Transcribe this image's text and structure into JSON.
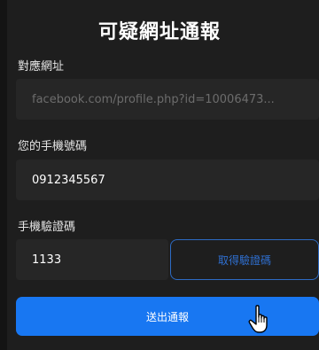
{
  "dialog": {
    "title": "可疑網址通報"
  },
  "form": {
    "url_label": "對應網址",
    "url_value": "facebook.com/profile.php?id=10006473...",
    "phone_label": "您的手機號碼",
    "phone_value": "0912345567",
    "code_label": "手機驗證碼",
    "code_value": "1133",
    "get_code_button": "取得驗證碼",
    "submit_button": "送出通報"
  },
  "colors": {
    "accent": "#1877f2",
    "outline": "#2d6bc4",
    "background": "#1e1e1e",
    "field": "#262626"
  },
  "cursor": {
    "icon": "hand-pointer-icon"
  }
}
